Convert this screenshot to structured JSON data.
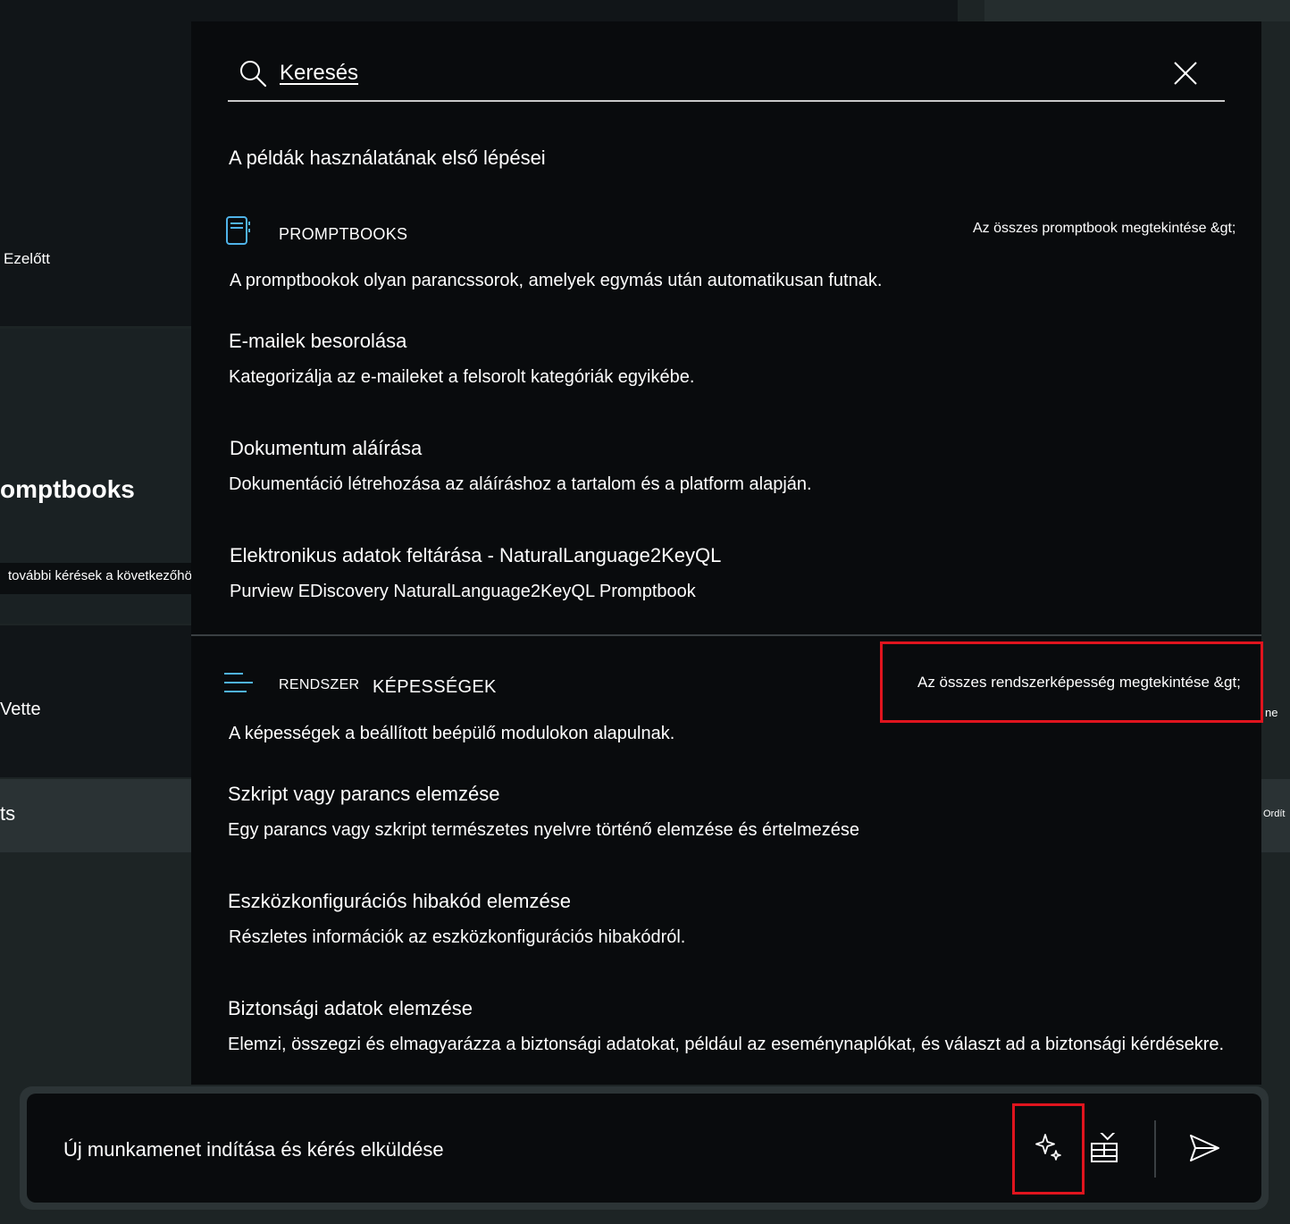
{
  "background": {
    "ezelott": "Ezelőtt",
    "promptbooks_heading": "omptbooks",
    "further_requests": "további kérések a következőhöz:",
    "vette": "Vette",
    "ts": "ts",
    "ne": "ne",
    "ordit": "Ordít"
  },
  "search": {
    "placeholder": "Keresés"
  },
  "intro_title": "A példák használatának első lépései",
  "promptbooks": {
    "label": "PROMPTBOOKS",
    "view_all": "Az összes promptbook megtekintése &gt;",
    "description": "A promptbookok olyan parancssorok, amelyek egymás után automatikusan futnak.",
    "items": [
      {
        "title": "E-mailek besorolása",
        "desc": "Kategorizálja az e-maileket a felsorolt kategóriák egyikébe."
      },
      {
        "title": "Dokumentum aláírása",
        "desc": "Dokumentáció létrehozása az aláíráshoz a tartalom és a platform alapján."
      },
      {
        "title": "Elektronikus adatok feltárása - NaturalLanguage2KeyQL",
        "desc": "Purview EDiscovery NaturalLanguage2KeyQL Promptbook"
      }
    ]
  },
  "capabilities": {
    "label_1": "RENDSZER",
    "label_2": "KÉPESSÉGEK",
    "view_all": "Az összes rendszerképesség megtekintése &gt;",
    "description": "A képességek a beállított beépülő modulokon alapulnak.",
    "items": [
      {
        "title": "Szkript vagy parancs elemzése",
        "desc": "Egy parancs vagy szkript természetes nyelvre történő elemzése és értelmezése"
      },
      {
        "title": "Eszközkonfigurációs hibakód elemzése",
        "desc": "Részletes információk az eszközkonfigurációs hibakódról."
      },
      {
        "title": "Biztonsági adatok elemzése",
        "desc": "Elemzi, összegzi és elmagyarázza a biztonsági adatokat, például az eseménynaplókat, és választ ad a biztonsági kérdésekre."
      }
    ]
  },
  "prompt_bar": {
    "placeholder": "Új munkamenet indítása és kérés elküldése"
  },
  "icons": {
    "search": "search-icon",
    "close": "close-icon",
    "promptbook": "notebook-icon",
    "capabilities": "lines-icon",
    "prompt_guide": "sparkle-icon",
    "plugins": "plugin-icon",
    "send": "send-icon"
  },
  "colors": {
    "highlight": "#e0141e",
    "panel": "#090b0d",
    "accent_icon": "#4fb3e8"
  }
}
